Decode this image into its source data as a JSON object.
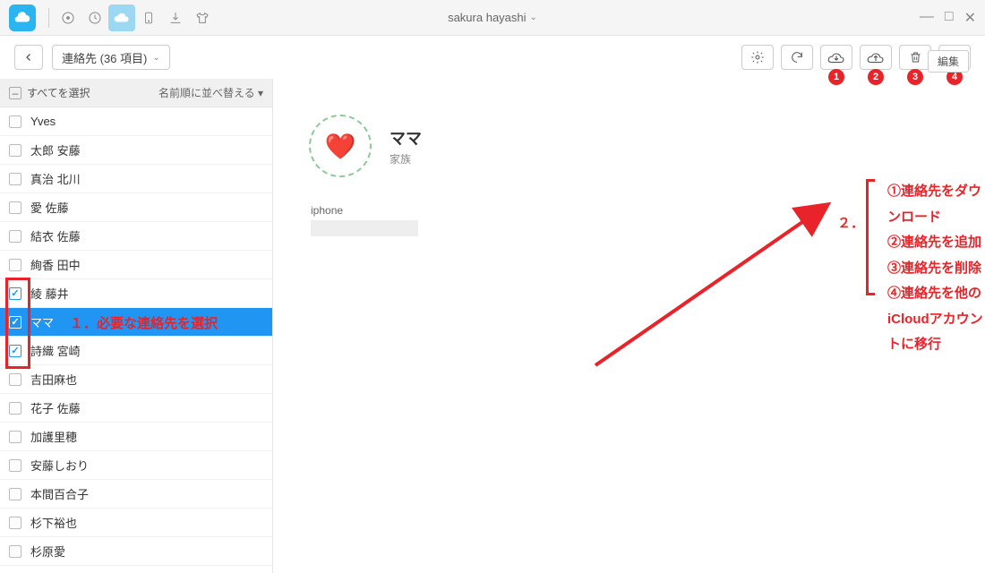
{
  "account_name": "sakura hayashi",
  "breadcrumb": "連絡先 (36 項目)",
  "list_header": {
    "select_all": "すべてを選択",
    "sort": "名前順に並べ替える"
  },
  "tooltip_edit": "編集",
  "contacts": [
    {
      "name": "Yves",
      "checked": false,
      "selected": false
    },
    {
      "name": "太郎 安藤",
      "checked": false,
      "selected": false
    },
    {
      "name": "真治 北川",
      "checked": false,
      "selected": false
    },
    {
      "name": "愛 佐藤",
      "checked": false,
      "selected": false
    },
    {
      "name": "結衣 佐藤",
      "checked": false,
      "selected": false
    },
    {
      "name": "絢香 田中",
      "checked": false,
      "selected": false
    },
    {
      "name": "綾 藤井",
      "checked": true,
      "selected": false
    },
    {
      "name": "ママ",
      "checked": true,
      "selected": true
    },
    {
      "name": "詩織 宮崎",
      "checked": true,
      "selected": false
    },
    {
      "name": "吉田麻也",
      "checked": false,
      "selected": false
    },
    {
      "name": "花子 佐藤",
      "checked": false,
      "selected": false
    },
    {
      "name": "加護里穂",
      "checked": false,
      "selected": false
    },
    {
      "name": "安藤しおり",
      "checked": false,
      "selected": false
    },
    {
      "name": "本間百合子",
      "checked": false,
      "selected": false
    },
    {
      "name": "杉下裕也",
      "checked": false,
      "selected": false
    },
    {
      "name": "杉原愛",
      "checked": false,
      "selected": false
    }
  ],
  "detail": {
    "name": "ママ",
    "group": "家族",
    "field_label": "iphone"
  },
  "toolbar_badges": [
    "1",
    "2",
    "3",
    "4"
  ],
  "annotations": {
    "step1": "１．必要な連絡先を選択",
    "step2": "２．",
    "legend": [
      "①連絡先をダウンロード",
      "②連絡先を追加",
      "③連絡先を削除",
      "④連絡先を他のiCloudアカウントに移行"
    ]
  }
}
